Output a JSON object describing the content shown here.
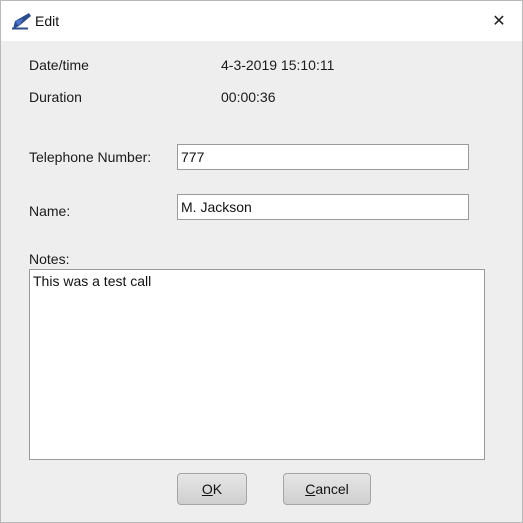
{
  "window": {
    "title": "Edit",
    "close_glyph": "✕",
    "app_icon": "feather-pen-icon"
  },
  "info": {
    "datetime_label": "Date/time",
    "datetime_value": "4-3-2019 15:10:11",
    "duration_label": "Duration",
    "duration_value": "00:00:36"
  },
  "form": {
    "telephone_label": "Telephone Number:",
    "telephone_value": "777",
    "name_label": "Name:",
    "name_value": "M. Jackson",
    "notes_label": "Notes:",
    "notes_value": "This was a test call"
  },
  "buttons": {
    "ok_mnemonic": "O",
    "ok_rest": "K",
    "cancel_mnemonic": "C",
    "cancel_rest": "ancel"
  },
  "colors": {
    "dialog_background": "#eeeeee",
    "titlebar_background": "#ffffff",
    "icon_blue": "#2e4d8c"
  }
}
